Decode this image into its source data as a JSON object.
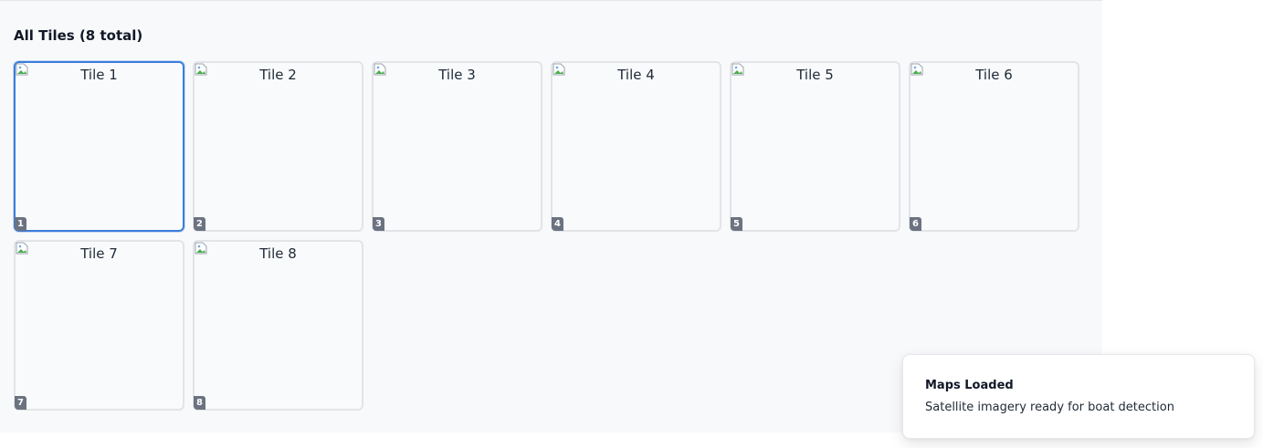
{
  "section": {
    "title": "All Tiles (8 total)"
  },
  "tiles": [
    {
      "alt": "Tile 1",
      "number": "1",
      "selected": true
    },
    {
      "alt": "Tile 2",
      "number": "2",
      "selected": false
    },
    {
      "alt": "Tile 3",
      "number": "3",
      "selected": false
    },
    {
      "alt": "Tile 4",
      "number": "4",
      "selected": false
    },
    {
      "alt": "Tile 5",
      "number": "5",
      "selected": false
    },
    {
      "alt": "Tile 6",
      "number": "6",
      "selected": false
    },
    {
      "alt": "Tile 7",
      "number": "7",
      "selected": false
    },
    {
      "alt": "Tile 8",
      "number": "8",
      "selected": false
    }
  ],
  "toast": {
    "title": "Maps Loaded",
    "description": "Satellite imagery ready for boat detection"
  },
  "colors": {
    "selected_border": "#3b7ddd",
    "tile_border": "#e2e4e8",
    "panel_background": "#f8f9fb",
    "badge_background": "#6b7280"
  },
  "icons": {
    "tile_image": "broken-image-icon"
  }
}
